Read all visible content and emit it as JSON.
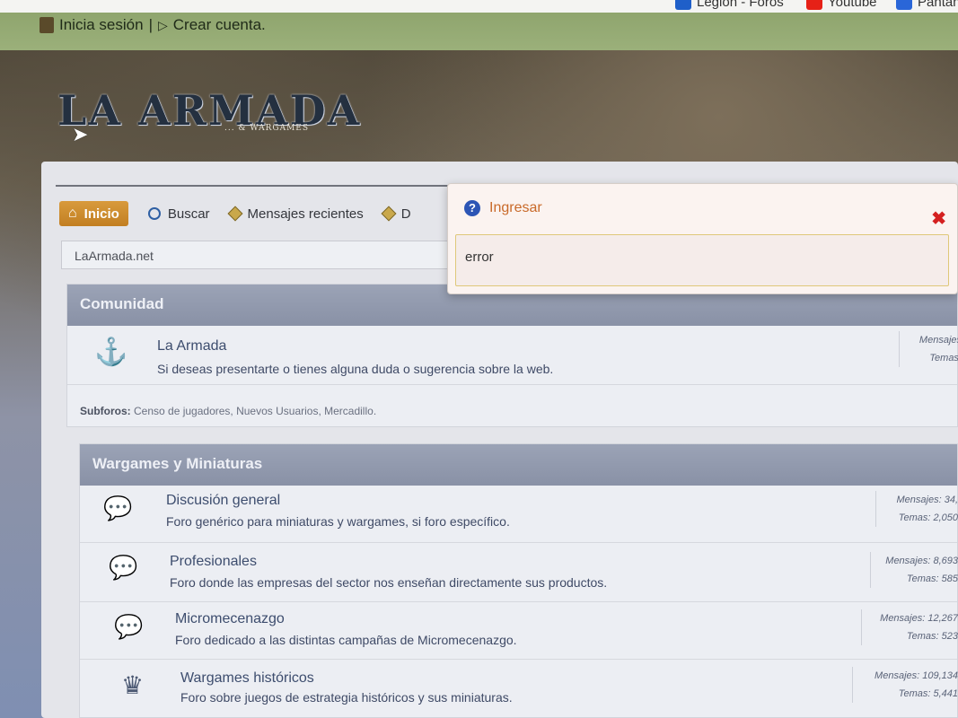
{
  "bookmarks": {
    "legion_label": "Legion - Foros",
    "youtube_label": "Youtube",
    "pantan_label": "Pantan"
  },
  "topbar": {
    "login_label": "Inicia sesión",
    "separator": "|",
    "register_label": "Crear cuenta."
  },
  "site": {
    "logo_text": "LA ARMADA",
    "logo_subtitle": "... & WARGAMES"
  },
  "nav": {
    "home_label": "Inicio",
    "search_label": "Buscar",
    "recent_label": "Mensajes recientes",
    "next_label": "D"
  },
  "breadcrumb": "LaArmada.net",
  "popup": {
    "title": "Ingresar",
    "message": "error"
  },
  "categories": [
    {
      "title": "Comunidad",
      "forums": [
        {
          "icon": "anchor-icon",
          "title": "La Armada",
          "description": "Si deseas presentarte o tienes alguna duda o sugerencia sobre la web.",
          "stats_messages": "Mensajes",
          "stats_topics": "Temas:"
        }
      ],
      "subforums_label": "Subforos:",
      "subforums_text": "Censo de jugadores, Nuevos Usuarios, Mercadillo."
    },
    {
      "title": "Wargames y Miniaturas",
      "forums": [
        {
          "icon": "chat-bubbles-icon",
          "title": "Discusión general",
          "description": "Foro genérico para miniaturas y wargames, si foro específico.",
          "stats_messages": "Mensajes: 34,",
          "stats_topics": "Temas: 2,050"
        },
        {
          "icon": "money-chat-icon",
          "title": "Profesionales",
          "description": "Foro donde las empresas del sector nos enseñan directamente sus productos.",
          "stats_messages": "Mensajes: 8,693",
          "stats_topics": "Temas: 585"
        },
        {
          "icon": "chat-bubbles-icon",
          "title": "Micromecenazgo",
          "description": "Foro dedicado a las distintas campañas de Micromecenazgo.",
          "stats_messages": "Mensajes: 12,267",
          "stats_topics": "Temas: 523"
        },
        {
          "icon": "crown-icon",
          "title": "Wargames históricos",
          "description": "Foro sobre juegos de estrategia históricos y sus miniaturas.",
          "stats_messages": "Mensajes: 109,134",
          "stats_topics": "Temas: 5,441"
        }
      ]
    }
  ],
  "colors": {
    "topbar": "#9bb07a",
    "home_button": "#d89a3c",
    "category_header": "#9ba3b6",
    "popup_title": "#c96a2a",
    "close": "#d42020"
  }
}
